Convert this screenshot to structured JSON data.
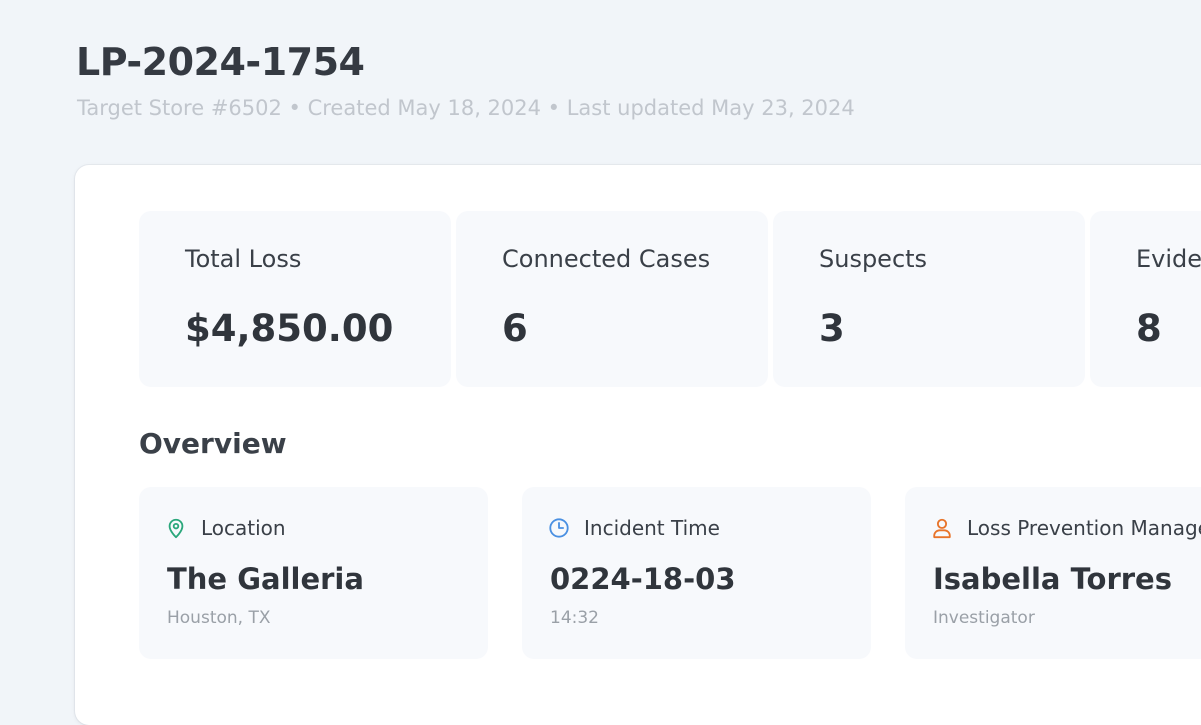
{
  "header": {
    "title": "LP-2024-1754",
    "subtitle": "Target Store #6502 • Created May 18, 2024 • Last updated May 23, 2024"
  },
  "stats": [
    {
      "label": "Total Loss",
      "value": "$4,850.00"
    },
    {
      "label": "Connected Cases",
      "value": "6"
    },
    {
      "label": "Suspects",
      "value": "3"
    },
    {
      "label": "Evidence",
      "value": "8"
    }
  ],
  "overview": {
    "title": "Overview",
    "items": [
      {
        "icon": "location-pin-icon",
        "label": "Location",
        "value": "The Galleria",
        "sub": "Houston, TX",
        "color": "#2aa77b"
      },
      {
        "icon": "clock-icon",
        "label": "Incident Time",
        "value": "0224-18-03",
        "sub": "14:32",
        "color": "#4a90e2"
      },
      {
        "icon": "person-icon",
        "label": "Loss Prevention Manager",
        "value": "Isabella Torres",
        "sub": "Investigator",
        "color": "#e8742a"
      }
    ]
  }
}
